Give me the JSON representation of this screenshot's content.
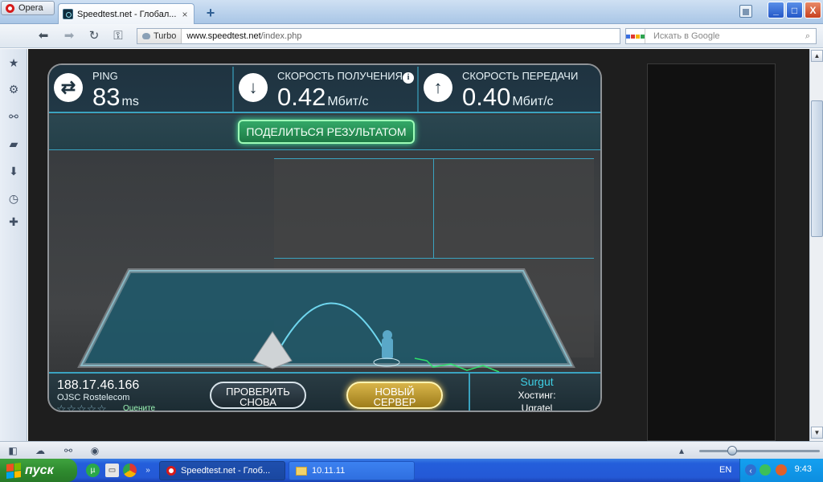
{
  "browser": {
    "menu_button": "Opera",
    "tab": {
      "title": "Speedtest.net - Глобал...",
      "close": "×"
    },
    "new_tab": "+",
    "window_controls": {
      "minimize": "_",
      "maximize": "□",
      "close": "X"
    }
  },
  "address_bar": {
    "turbo_label": "Turbo",
    "url_prefix": "www.speedtest.net",
    "url_path": "/index.php",
    "search_placeholder": "Искать в Google"
  },
  "speedtest": {
    "ping": {
      "label": "PING",
      "value": "83",
      "unit": "ms"
    },
    "download": {
      "label": "СКОРОСТЬ ПОЛУЧЕНИЯ",
      "value": "0.42",
      "unit": "Мбит/с"
    },
    "upload": {
      "label": "СКОРОСТЬ ПЕРЕДАЧИ",
      "value": "0.40",
      "unit": "Мбит/с"
    },
    "info_glyph": "i",
    "share_button": "ПОДЕЛИТЬСЯ РЕЗУЛЬТАТОМ",
    "client": {
      "ip": "188.17.46.166",
      "isp": "OJSC Rostelecom",
      "stars": "☆☆☆☆☆",
      "rate_label": "Оцените"
    },
    "retry_button": {
      "line1": "ПРОВЕРИТЬ",
      "line2": "СНОВА"
    },
    "new_server_button": {
      "line1": "НОВЫЙ",
      "line2": "СЕРВЕР"
    },
    "server": {
      "city": "Surgut",
      "hosting_label": "Хостинг:",
      "host": "Ugratel"
    }
  },
  "taskbar": {
    "start_label": "пуск",
    "tasks": [
      {
        "label": "Speedtest.net - Глоб..."
      },
      {
        "label": "10.11.11"
      }
    ],
    "language": "EN",
    "clock": "9:43"
  },
  "colors": {
    "accent_cyan": "#3aa3c0",
    "share_green": "#33a868",
    "new_server_gold": "#d9b54a",
    "taskbar_blue": "#245edb"
  },
  "icons": {
    "ping": "exchange-arrows-icon",
    "download": "arrow-down-icon",
    "upload": "arrow-up-icon"
  }
}
